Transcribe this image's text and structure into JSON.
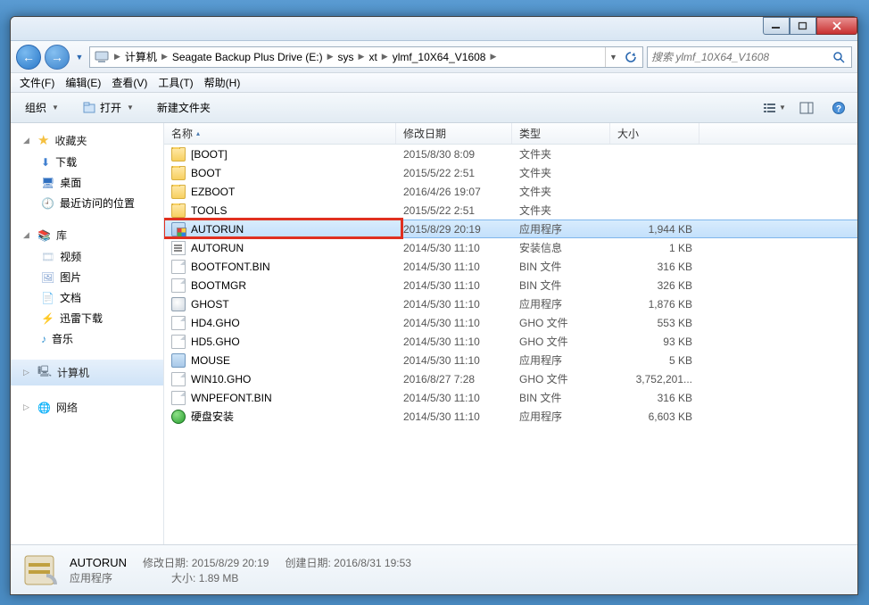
{
  "window": {
    "titlebar": {},
    "breadcrumb": {
      "root_icon": "computer-icon",
      "parts": [
        "计算机",
        "Seagate Backup Plus Drive (E:)",
        "sys",
        "xt",
        "ylmf_10X64_V1608"
      ]
    },
    "search": {
      "placeholder": "搜索 ylmf_10X64_V1608"
    }
  },
  "menu": {
    "file": "文件(F)",
    "edit": "编辑(E)",
    "view": "查看(V)",
    "tools": "工具(T)",
    "help": "帮助(H)"
  },
  "toolbar": {
    "organize": "组织",
    "open": "打开",
    "newfolder": "新建文件夹"
  },
  "sidebar": {
    "fav_hdr": "收藏夹",
    "fav": {
      "downloads": "下载",
      "desktop": "桌面",
      "recent": "最近访问的位置"
    },
    "lib_hdr": "库",
    "lib": {
      "video": "视频",
      "pictures": "图片",
      "docs": "文档",
      "xunlei": "迅雷下载",
      "music": "音乐"
    },
    "computer": "计算机",
    "network": "网络"
  },
  "columns": {
    "name": "名称",
    "date": "修改日期",
    "type": "类型",
    "size": "大小"
  },
  "types": {
    "folder": "文件夹",
    "app": "应用程序",
    "ini": "安装信息",
    "bin": "BIN 文件",
    "gho": "GHO 文件"
  },
  "rows": [
    {
      "icon": "folder",
      "name": "[BOOT]",
      "date": "2015/8/30 8:09",
      "type_key": "folder",
      "size": ""
    },
    {
      "icon": "folder",
      "name": "BOOT",
      "date": "2015/5/22 2:51",
      "type_key": "folder",
      "size": ""
    },
    {
      "icon": "folder",
      "name": "EZBOOT",
      "date": "2016/4/26 19:07",
      "type_key": "folder",
      "size": ""
    },
    {
      "icon": "folder",
      "name": "TOOLS",
      "date": "2015/5/22 2:51",
      "type_key": "folder",
      "size": ""
    },
    {
      "icon": "exe-shield",
      "name": "AUTORUN",
      "date": "2015/8/29 20:19",
      "type_key": "app",
      "size": "1,944 KB",
      "selected": true,
      "highlight": true
    },
    {
      "icon": "ini",
      "name": "AUTORUN",
      "date": "2014/5/30 11:10",
      "type_key": "ini",
      "size": "1 KB"
    },
    {
      "icon": "file",
      "name": "BOOTFONT.BIN",
      "date": "2014/5/30 11:10",
      "type_key": "bin",
      "size": "316 KB"
    },
    {
      "icon": "file",
      "name": "BOOTMGR",
      "date": "2014/5/30 11:10",
      "type_key": "bin",
      "size": "326 KB"
    },
    {
      "icon": "ghost",
      "name": "GHOST",
      "date": "2014/5/30 11:10",
      "type_key": "app",
      "size": "1,876 KB"
    },
    {
      "icon": "file",
      "name": "HD4.GHO",
      "date": "2014/5/30 11:10",
      "type_key": "gho",
      "size": "553 KB"
    },
    {
      "icon": "file",
      "name": "HD5.GHO",
      "date": "2014/5/30 11:10",
      "type_key": "gho",
      "size": "93 KB"
    },
    {
      "icon": "exe",
      "name": "MOUSE",
      "date": "2014/5/30 11:10",
      "type_key": "app",
      "size": "5 KB"
    },
    {
      "icon": "file",
      "name": "WIN10.GHO",
      "date": "2016/8/27 7:28",
      "type_key": "gho",
      "size": "3,752,201..."
    },
    {
      "icon": "file",
      "name": "WNPEFONT.BIN",
      "date": "2014/5/30 11:10",
      "type_key": "bin",
      "size": "316 KB"
    },
    {
      "icon": "globe",
      "name": "硬盘安装",
      "date": "2014/5/30 11:10",
      "type_key": "app",
      "size": "6,603 KB"
    }
  ],
  "details": {
    "name": "AUTORUN",
    "type": "应用程序",
    "mod_label": "修改日期:",
    "mod_value": "2015/8/29 20:19",
    "size_label": "大小:",
    "size_value": "1.89 MB",
    "created_label": "创建日期:",
    "created_value": "2016/8/31 19:53"
  }
}
